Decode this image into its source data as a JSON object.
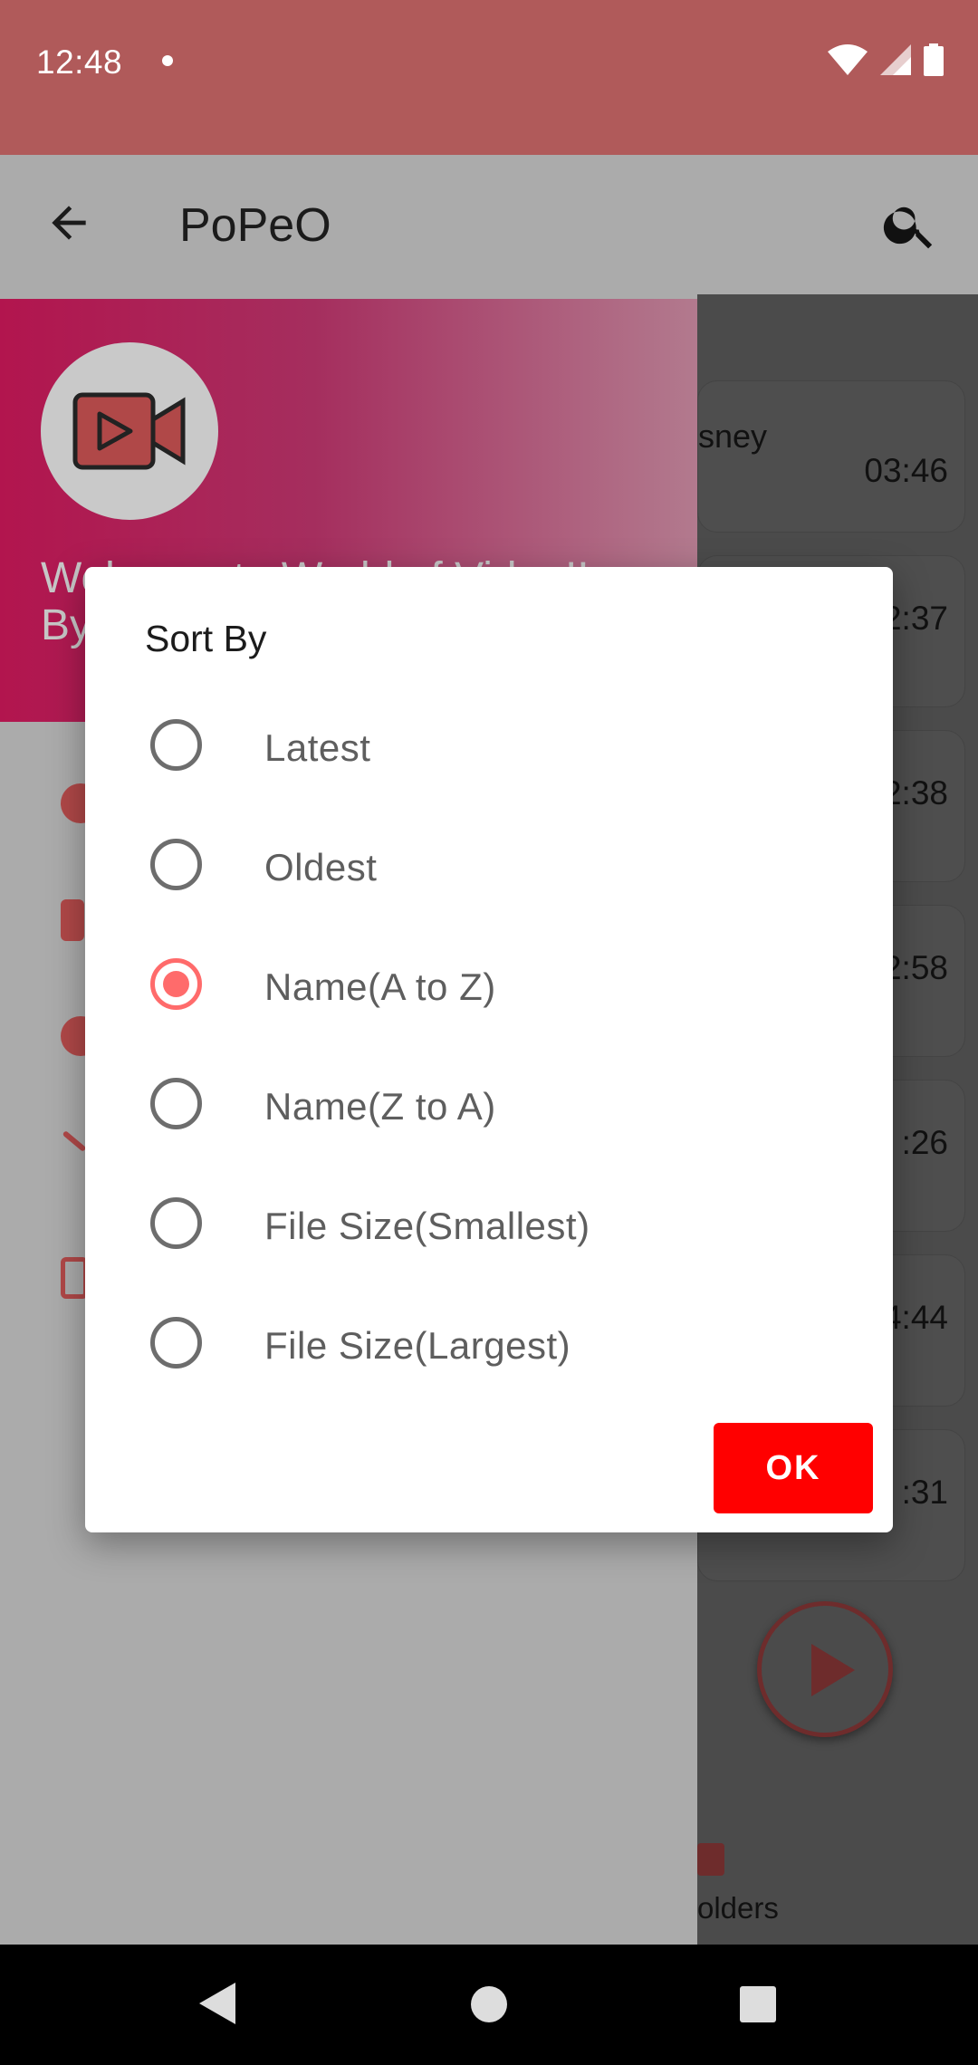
{
  "status_bar": {
    "time": "12:48"
  },
  "app_bar": {
    "title": "PoPeO"
  },
  "drawer": {
    "welcome": "Welcome to World of Video!!\nBy"
  },
  "video_list": [
    {
      "title": "sney",
      "duration": "03:46"
    },
    {
      "title": "",
      "duration": "2:37"
    },
    {
      "title": "",
      "duration": "2:38"
    },
    {
      "title": "",
      "duration": "2:58"
    },
    {
      "title": "",
      "duration": ":26"
    },
    {
      "title": "",
      "duration": "4:44"
    },
    {
      "title": "",
      "duration": ":31"
    }
  ],
  "bottom_tab": {
    "folders_label": "olders"
  },
  "dialog": {
    "title": "Sort By",
    "options": [
      {
        "label": "Latest",
        "checked": false
      },
      {
        "label": "Oldest",
        "checked": false
      },
      {
        "label": "Name(A to Z)",
        "checked": true
      },
      {
        "label": "Name(Z to A)",
        "checked": false
      },
      {
        "label": "File Size(Smallest)",
        "checked": false
      },
      {
        "label": "File Size(Largest)",
        "checked": false
      }
    ],
    "ok_label": "OK"
  },
  "colors": {
    "status_bar": "#b05a5a",
    "accent_radio": "#ff6b6b",
    "ok_button": "#ff0000",
    "drawer_header_start": "#b2154e"
  },
  "icons": {
    "status": [
      "wifi-icon",
      "signal-icon",
      "battery-icon"
    ],
    "app_bar": [
      "back-arrow-icon",
      "search-icon"
    ],
    "nav": [
      "nav-back-icon",
      "nav-home-icon",
      "nav-recents-icon"
    ]
  }
}
